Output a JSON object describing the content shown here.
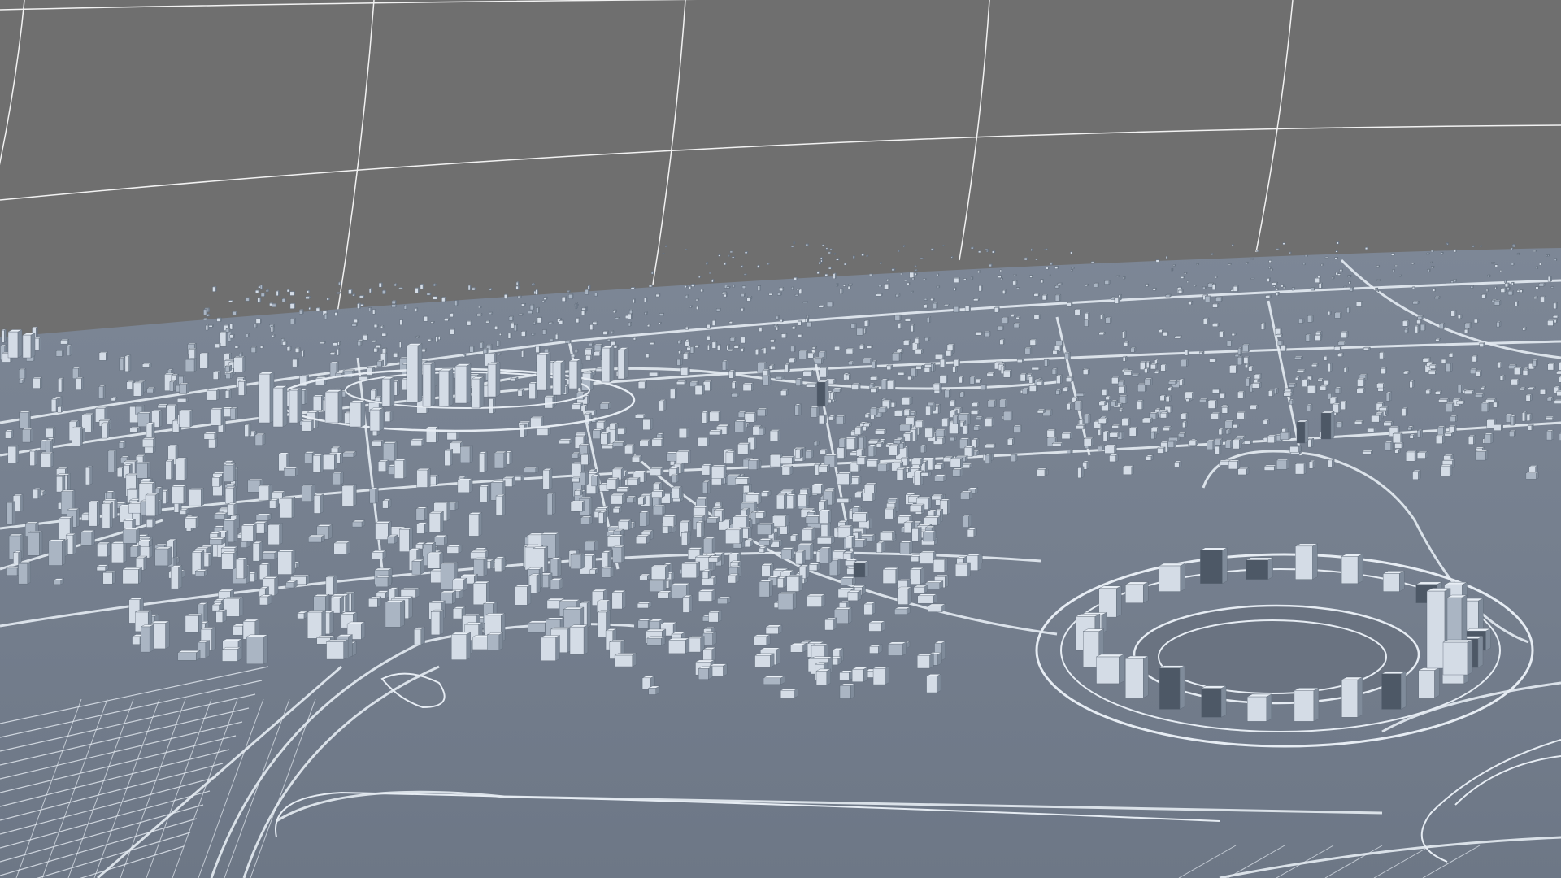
{
  "scene": {
    "kind": "3d-wireframe-city-model-render",
    "colors": {
      "background": "#6f6f6f",
      "dome_grid_line": "#f2f2f2",
      "ground": "#6d7786",
      "ground_far": "#7d8796",
      "road": "#e6ecf3",
      "building_face_light": "#d4dce6",
      "building_face_mid": "#aab5c3",
      "building_face_dark": "#7f8b9a",
      "building_glass": "#4d5866",
      "water": "#6a7381"
    },
    "features": [
      "skydome-grid",
      "city-ground-plane",
      "downtown-cluster",
      "circular-lake-district",
      "irrigation-fields"
    ]
  }
}
